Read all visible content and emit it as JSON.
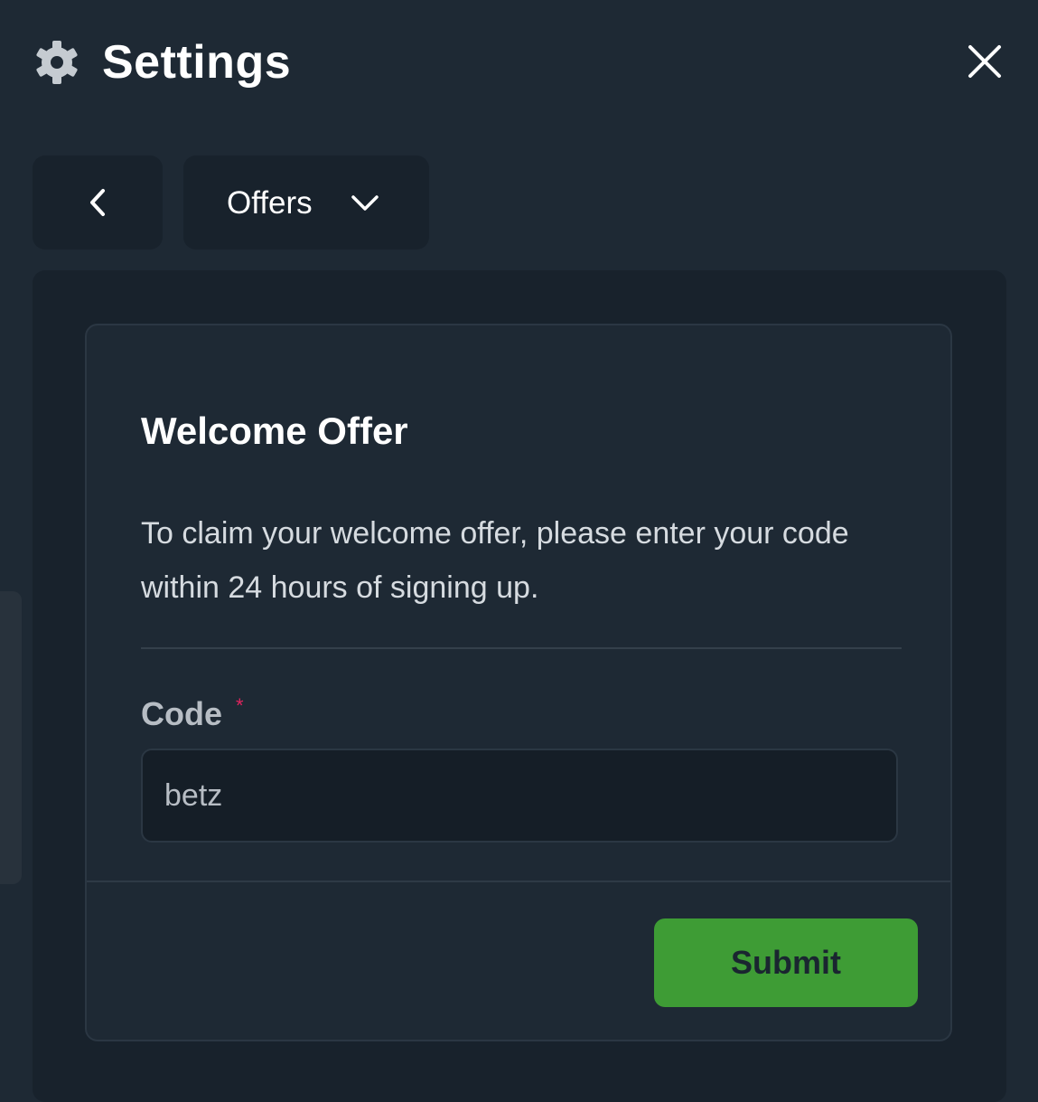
{
  "header": {
    "title": "Settings",
    "gear_icon": "gear-icon",
    "close_icon": "close-icon"
  },
  "nav": {
    "back_icon": "chevron-left-icon",
    "section_selected": "Offers",
    "dropdown_icon": "chevron-down-icon"
  },
  "card": {
    "title": "Welcome Offer",
    "description": "To claim your welcome offer, please enter your code within 24 hours of signing up.",
    "code_label": "Code",
    "required_mark": "*",
    "code_value": "betz",
    "submit_label": "Submit"
  },
  "colors": {
    "background": "#1e2934",
    "panel": "#18222c",
    "accent_green": "#3e9c35",
    "required_red": "#e0245e"
  }
}
